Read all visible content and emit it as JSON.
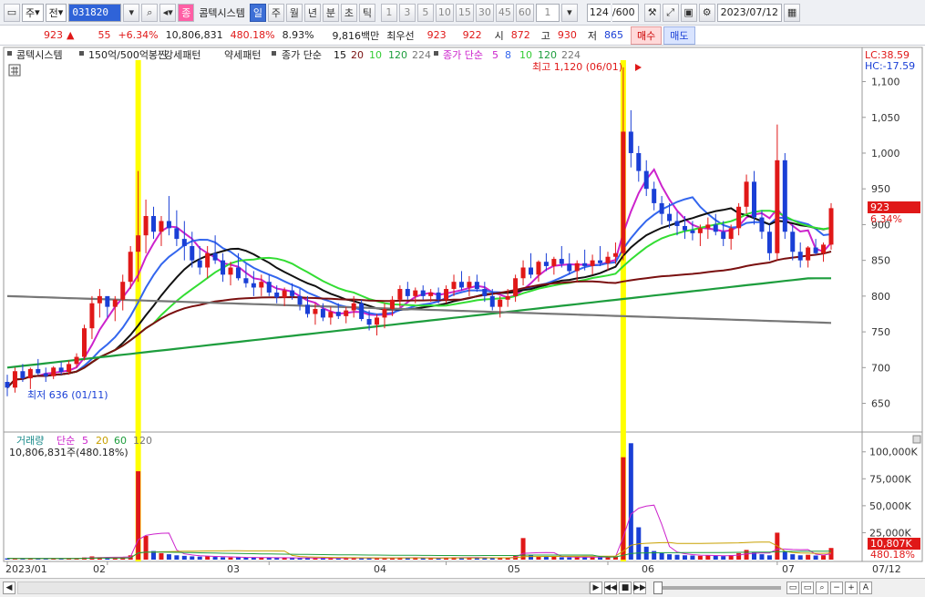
{
  "toolbar": {
    "market": "주",
    "prefix": "전",
    "code": "031820",
    "stock_badge": "종",
    "stock_name": "콤텍시스템",
    "periods": [
      "일",
      "주",
      "월",
      "년",
      "분",
      "초",
      "틱"
    ],
    "active_period": "일",
    "intervals": [
      "1",
      "3",
      "5",
      "10",
      "15",
      "30",
      "45",
      "60"
    ],
    "interval_value": "1",
    "count_current": "124",
    "count_total": "/600",
    "date": "2023/07/12"
  },
  "quote": {
    "price": "923",
    "change_arrow": "▲",
    "change": "55",
    "change_pct": "+6.34%",
    "volume": "10,806,831",
    "volume_ratio": "480.18%",
    "turnover": "8.93%",
    "amount": "9,816백만",
    "best_label": "최우선",
    "ask": "923",
    "bid": "922",
    "open_label": "시",
    "open": "872",
    "high_label": "고",
    "high": "930",
    "low_label": "저",
    "low": "865",
    "buy_label": "매수",
    "sell_label": "매도"
  },
  "legend_price": {
    "name": "콤텍시스템",
    "pattern1": "150억/500억봉찐",
    "pattern2": "강세패턴",
    "pattern3": "약세패턴",
    "ma1_title": "종가 단순",
    "ma1_periods": [
      "15",
      "20",
      "10",
      "120",
      "224"
    ],
    "ma2_title": "종가 단순",
    "ma2_periods": [
      "5",
      "8",
      "10",
      "120",
      "224"
    ],
    "lc": "LC:38.59",
    "hc": "HC:-17.59"
  },
  "legend_volume": {
    "title": "거래량",
    "ma_title": "단순",
    "ma_periods": [
      "5",
      "20",
      "60",
      "120"
    ],
    "summary": "10,806,831주(480.18%)"
  },
  "annotations": {
    "high_text": "최고 1,120 (06/01)",
    "low_text": "최저 636 (01/11)"
  },
  "price_axis": [
    "1,100",
    "1,050",
    "1,000",
    "950",
    "900",
    "850",
    "800",
    "750",
    "700",
    "650"
  ],
  "price_tag": {
    "value": "923",
    "pct": "6.34%"
  },
  "volume_axis": [
    "100,000K",
    "75,000K",
    "50,000K",
    "25,000K"
  ],
  "volume_tag": {
    "value": "10,807K",
    "pct": "480.18%"
  },
  "date_axis": [
    "2023/01",
    "02",
    "03",
    "04",
    "05",
    "06",
    "07"
  ],
  "date_axis_end": "07/12",
  "colors": {
    "up": "#e01818",
    "down": "#1a3fd6",
    "highlight": "#ffff00"
  },
  "chart_data": {
    "type": "candlestick",
    "ylim": [
      615,
      1130
    ],
    "candles": [
      [
        680,
        690,
        660,
        672
      ],
      [
        672,
        700,
        665,
        695
      ],
      [
        695,
        705,
        680,
        685
      ],
      [
        685,
        700,
        670,
        698
      ],
      [
        698,
        712,
        690,
        692
      ],
      [
        692,
        700,
        680,
        688
      ],
      [
        688,
        702,
        684,
        700
      ],
      [
        700,
        708,
        690,
        694
      ],
      [
        694,
        710,
        690,
        705
      ],
      [
        705,
        720,
        700,
        715
      ],
      [
        715,
        760,
        710,
        755
      ],
      [
        755,
        800,
        740,
        790
      ],
      [
        790,
        810,
        770,
        800
      ],
      [
        800,
        790,
        770,
        785
      ],
      [
        785,
        800,
        765,
        795
      ],
      [
        795,
        830,
        780,
        820
      ],
      [
        820,
        870,
        810,
        862
      ],
      [
        862,
        975,
        820,
        885
      ],
      [
        885,
        935,
        860,
        912
      ],
      [
        912,
        925,
        880,
        890
      ],
      [
        890,
        912,
        870,
        905
      ],
      [
        905,
        940,
        885,
        895
      ],
      [
        895,
        920,
        870,
        880
      ],
      [
        880,
        905,
        850,
        870
      ],
      [
        870,
        890,
        840,
        850
      ],
      [
        850,
        870,
        830,
        840
      ],
      [
        840,
        870,
        825,
        860
      ],
      [
        860,
        885,
        845,
        850
      ],
      [
        850,
        860,
        820,
        830
      ],
      [
        830,
        848,
        815,
        840
      ],
      [
        840,
        860,
        822,
        825
      ],
      [
        825,
        845,
        812,
        818
      ],
      [
        818,
        835,
        800,
        812
      ],
      [
        812,
        830,
        800,
        820
      ],
      [
        820,
        830,
        800,
        805
      ],
      [
        805,
        815,
        790,
        798
      ],
      [
        798,
        812,
        786,
        808
      ],
      [
        808,
        818,
        795,
        800
      ],
      [
        800,
        810,
        780,
        788
      ],
      [
        788,
        800,
        770,
        775
      ],
      [
        775,
        790,
        760,
        782
      ],
      [
        782,
        790,
        765,
        770
      ],
      [
        770,
        785,
        760,
        778
      ],
      [
        778,
        790,
        768,
        772
      ],
      [
        772,
        785,
        762,
        780
      ],
      [
        780,
        800,
        770,
        790
      ],
      [
        790,
        795,
        765,
        768
      ],
      [
        768,
        780,
        752,
        760
      ],
      [
        760,
        775,
        745,
        770
      ],
      [
        770,
        790,
        755,
        782
      ],
      [
        782,
        800,
        772,
        795
      ],
      [
        795,
        815,
        785,
        810
      ],
      [
        810,
        820,
        795,
        800
      ],
      [
        800,
        812,
        790,
        808
      ],
      [
        808,
        815,
        795,
        800
      ],
      [
        800,
        810,
        792,
        805
      ],
      [
        805,
        812,
        790,
        795
      ],
      [
        795,
        815,
        790,
        810
      ],
      [
        810,
        830,
        800,
        820
      ],
      [
        820,
        835,
        808,
        812
      ],
      [
        812,
        828,
        800,
        820
      ],
      [
        820,
        830,
        806,
        810
      ],
      [
        810,
        820,
        792,
        800
      ],
      [
        800,
        810,
        780,
        785
      ],
      [
        785,
        800,
        770,
        795
      ],
      [
        795,
        810,
        785,
        800
      ],
      [
        800,
        830,
        792,
        825
      ],
      [
        825,
        850,
        815,
        840
      ],
      [
        840,
        860,
        825,
        830
      ],
      [
        830,
        850,
        820,
        848
      ],
      [
        848,
        860,
        835,
        842
      ],
      [
        842,
        855,
        830,
        852
      ],
      [
        852,
        870,
        840,
        845
      ],
      [
        845,
        860,
        830,
        835
      ],
      [
        835,
        850,
        820,
        846
      ],
      [
        846,
        865,
        836,
        842
      ],
      [
        842,
        858,
        830,
        850
      ],
      [
        850,
        870,
        842,
        846
      ],
      [
        846,
        862,
        836,
        855
      ],
      [
        855,
        875,
        845,
        860
      ],
      [
        860,
        1120,
        850,
        1030
      ],
      [
        1030,
        1060,
        980,
        1000
      ],
      [
        1000,
        1010,
        960,
        975
      ],
      [
        975,
        990,
        940,
        950
      ],
      [
        950,
        960,
        920,
        930
      ],
      [
        930,
        940,
        900,
        915
      ],
      [
        915,
        930,
        895,
        905
      ],
      [
        905,
        918,
        885,
        898
      ],
      [
        898,
        912,
        880,
        892
      ],
      [
        892,
        905,
        878,
        888
      ],
      [
        888,
        900,
        870,
        895
      ],
      [
        895,
        910,
        880,
        900
      ],
      [
        900,
        915,
        885,
        890
      ],
      [
        890,
        905,
        870,
        880
      ],
      [
        880,
        900,
        865,
        895
      ],
      [
        895,
        930,
        885,
        925
      ],
      [
        925,
        970,
        915,
        960
      ],
      [
        960,
        975,
        900,
        910
      ],
      [
        910,
        920,
        880,
        890
      ],
      [
        890,
        900,
        850,
        860
      ],
      [
        860,
        1040,
        850,
        990
      ],
      [
        990,
        1000,
        880,
        890
      ],
      [
        890,
        900,
        850,
        862
      ],
      [
        862,
        875,
        840,
        850
      ],
      [
        850,
        870,
        840,
        868
      ],
      [
        868,
        880,
        858,
        860
      ],
      [
        860,
        875,
        848,
        872
      ],
      [
        872,
        930,
        865,
        923
      ]
    ],
    "volume": [
      1.2,
      1.0,
      1.1,
      0.9,
      1.3,
      1.0,
      1.1,
      0.9,
      1.2,
      1.4,
      2.0,
      3.0,
      2.2,
      2.0,
      1.8,
      2.5,
      4.0,
      82.0,
      22.0,
      8.0,
      6.0,
      5.0,
      4.0,
      3.5,
      3.0,
      2.8,
      3.0,
      2.5,
      2.2,
      2.0,
      2.1,
      1.9,
      1.8,
      2.0,
      1.7,
      1.6,
      1.8,
      1.5,
      1.6,
      1.4,
      1.5,
      1.3,
      1.4,
      1.2,
      1.6,
      2.0,
      1.5,
      1.3,
      1.4,
      1.6,
      1.8,
      2.0,
      1.7,
      1.6,
      1.5,
      1.4,
      1.6,
      1.9,
      2.2,
      1.8,
      1.7,
      1.6,
      1.5,
      2.0,
      1.8,
      1.7,
      3.5,
      20.0,
      4.0,
      3.0,
      2.5,
      2.8,
      2.2,
      2.0,
      2.5,
      2.4,
      2.6,
      2.2,
      2.3,
      3.0,
      95.0,
      108.0,
      30.0,
      12.0,
      8.0,
      6.0,
      5.0,
      4.5,
      4.0,
      3.8,
      3.5,
      4.0,
      3.6,
      3.3,
      4.2,
      6.0,
      9.0,
      7.0,
      5.0,
      4.0,
      25.0,
      8.0,
      5.0,
      4.0,
      4.5,
      3.8,
      4.0,
      10.8
    ],
    "ma_lines": [
      {
        "name": "5",
        "color": "#cc22cc"
      },
      {
        "name": "10",
        "color": "#3366ee"
      },
      {
        "name": "15",
        "color": "#111111"
      },
      {
        "name": "20",
        "color": "#33dd33"
      },
      {
        "name": "60",
        "color": "#7a1010"
      },
      {
        "name": "120",
        "color": "#1d9d3d"
      },
      {
        "name": "224",
        "color": "#777777"
      }
    ]
  }
}
